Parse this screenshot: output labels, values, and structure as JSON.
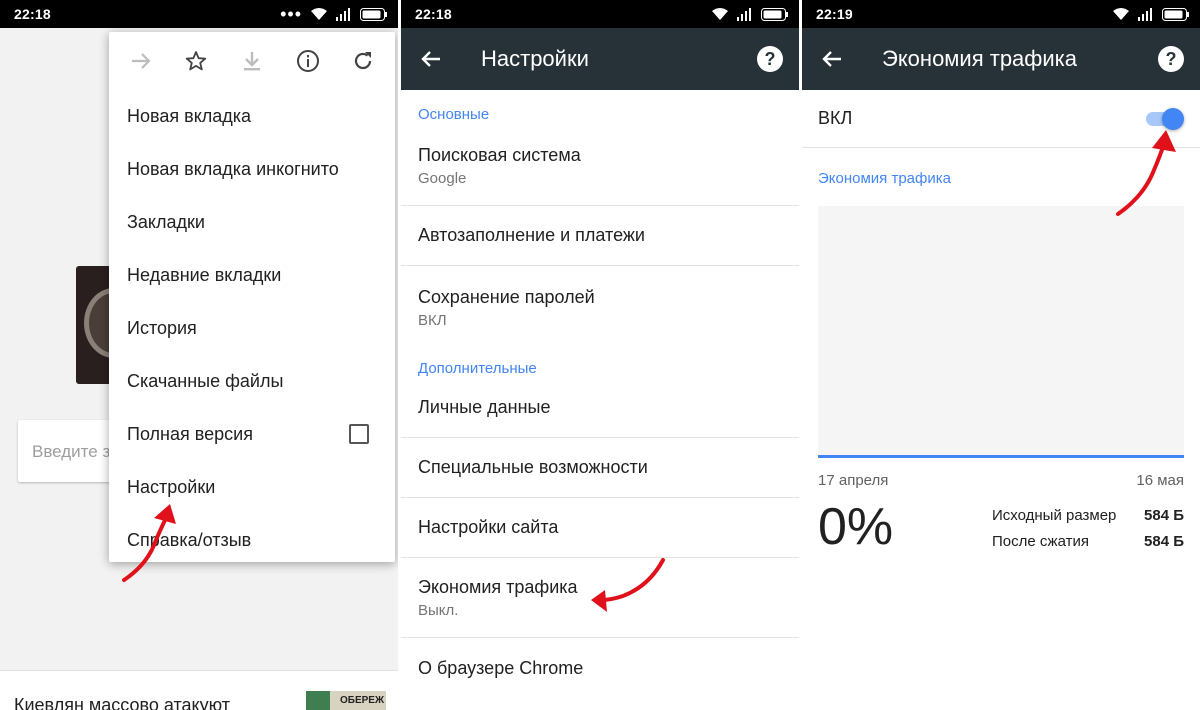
{
  "status_bar": [
    {
      "time": "22:18"
    },
    {
      "time": "22:18"
    },
    {
      "time": "22:19"
    }
  ],
  "panel1": {
    "search_placeholder": "Введите з",
    "news_headline": "Киевлян массово атакуют",
    "news_thumb_text": "ОБЕРЕЖ",
    "menu": {
      "icons": [
        "forward-icon",
        "star-icon",
        "download-icon",
        "info-icon",
        "refresh-icon"
      ],
      "items": [
        "Новая вкладка",
        "Новая вкладка инкогнито",
        "Закладки",
        "Недавние вкладки",
        "История",
        "Скачанные файлы",
        "Полная версия",
        "Настройки",
        "Справка/отзыв"
      ]
    }
  },
  "panel2": {
    "title": "Настройки",
    "help": "?",
    "section_basic": "Основные",
    "section_advanced": "Дополнительные",
    "items": [
      {
        "label": "Поисковая система",
        "sub": "Google"
      },
      {
        "label": "Автозаполнение и платежи"
      },
      {
        "label": "Сохранение паролей",
        "sub": "ВКЛ"
      },
      {
        "label": "Личные данные"
      },
      {
        "label": "Специальные возможности"
      },
      {
        "label": "Настройки сайта"
      },
      {
        "label": "Экономия трафика",
        "sub": "Выкл."
      },
      {
        "label": "О браузере Chrome"
      }
    ]
  },
  "panel3": {
    "title": "Экономия трафика",
    "help": "?",
    "toggle_label": "ВКЛ",
    "toggle_on": true,
    "section": "Экономия трафика",
    "date_start": "17 апреля",
    "date_end": "16 мая",
    "percent": "0%",
    "original_size_label": "Исходный размер",
    "original_size_value": "584 Б",
    "compressed_label": "После сжатия",
    "compressed_value": "584 Б"
  },
  "colors": {
    "appbar": "#263238",
    "accent": "#4285f4",
    "annotation_arrow": "#e0111b"
  }
}
